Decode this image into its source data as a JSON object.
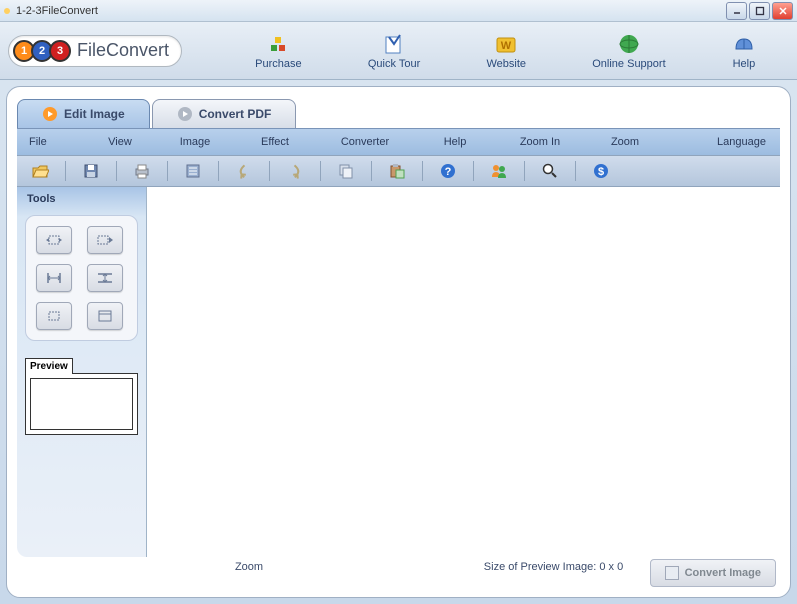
{
  "titlebar": {
    "title": "1-2-3FileConvert"
  },
  "logo": {
    "text": "FileConvert",
    "n1": "1",
    "n2": "2",
    "n3": "3"
  },
  "topnav": {
    "purchase": "Purchase",
    "quicktour": "Quick Tour",
    "website": "Website",
    "support": "Online Support",
    "help": "Help"
  },
  "tabs": {
    "edit": "Edit Image",
    "convert": "Convert PDF"
  },
  "menu": {
    "file": "File",
    "view": "View",
    "image": "Image",
    "effect": "Effect",
    "converter": "Converter",
    "help": "Help",
    "zoomin": "Zoom In",
    "zoom": "Zoom",
    "language": "Language"
  },
  "panel": {
    "tools": "Tools",
    "preview": "Preview"
  },
  "status": {
    "zoom": "Zoom",
    "size": "Size of Preview Image: 0 x 0"
  },
  "convert_button": "Convert Image"
}
